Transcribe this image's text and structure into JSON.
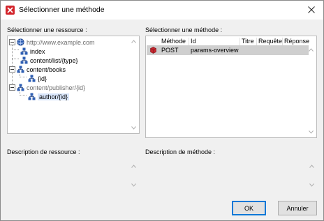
{
  "window": {
    "title": "Sélectionner une méthode"
  },
  "resource_panel": {
    "label": "Sélectionner une ressource :",
    "tree": [
      {
        "label": "http://www.example.com",
        "muted": true
      },
      {
        "label": "index",
        "muted": false
      },
      {
        "label": "content/list/{type}",
        "muted": false
      },
      {
        "label": "content/books",
        "muted": false
      },
      {
        "label": "{id}",
        "muted": false
      },
      {
        "label": "content/publisher/{id}",
        "muted": true
      },
      {
        "label": "author/{id}",
        "muted": false,
        "selected": true
      }
    ]
  },
  "method_panel": {
    "label": "Sélectionner une méthode :",
    "columns": [
      "Méthode",
      "Id",
      "Titre",
      "Requête",
      "Réponse"
    ],
    "rows": [
      {
        "method": "POST",
        "id": "params-overview",
        "title": "",
        "request": "",
        "response": ""
      }
    ]
  },
  "resource_description": {
    "label": "Description de ressource :"
  },
  "method_description": {
    "label": "Description de méthode :"
  },
  "buttons": {
    "ok": "OK",
    "cancel": "Annuler"
  },
  "colors": {
    "accent": "#0078d7",
    "selection": "#cfcfcf",
    "app_icon": "#d3242b"
  }
}
